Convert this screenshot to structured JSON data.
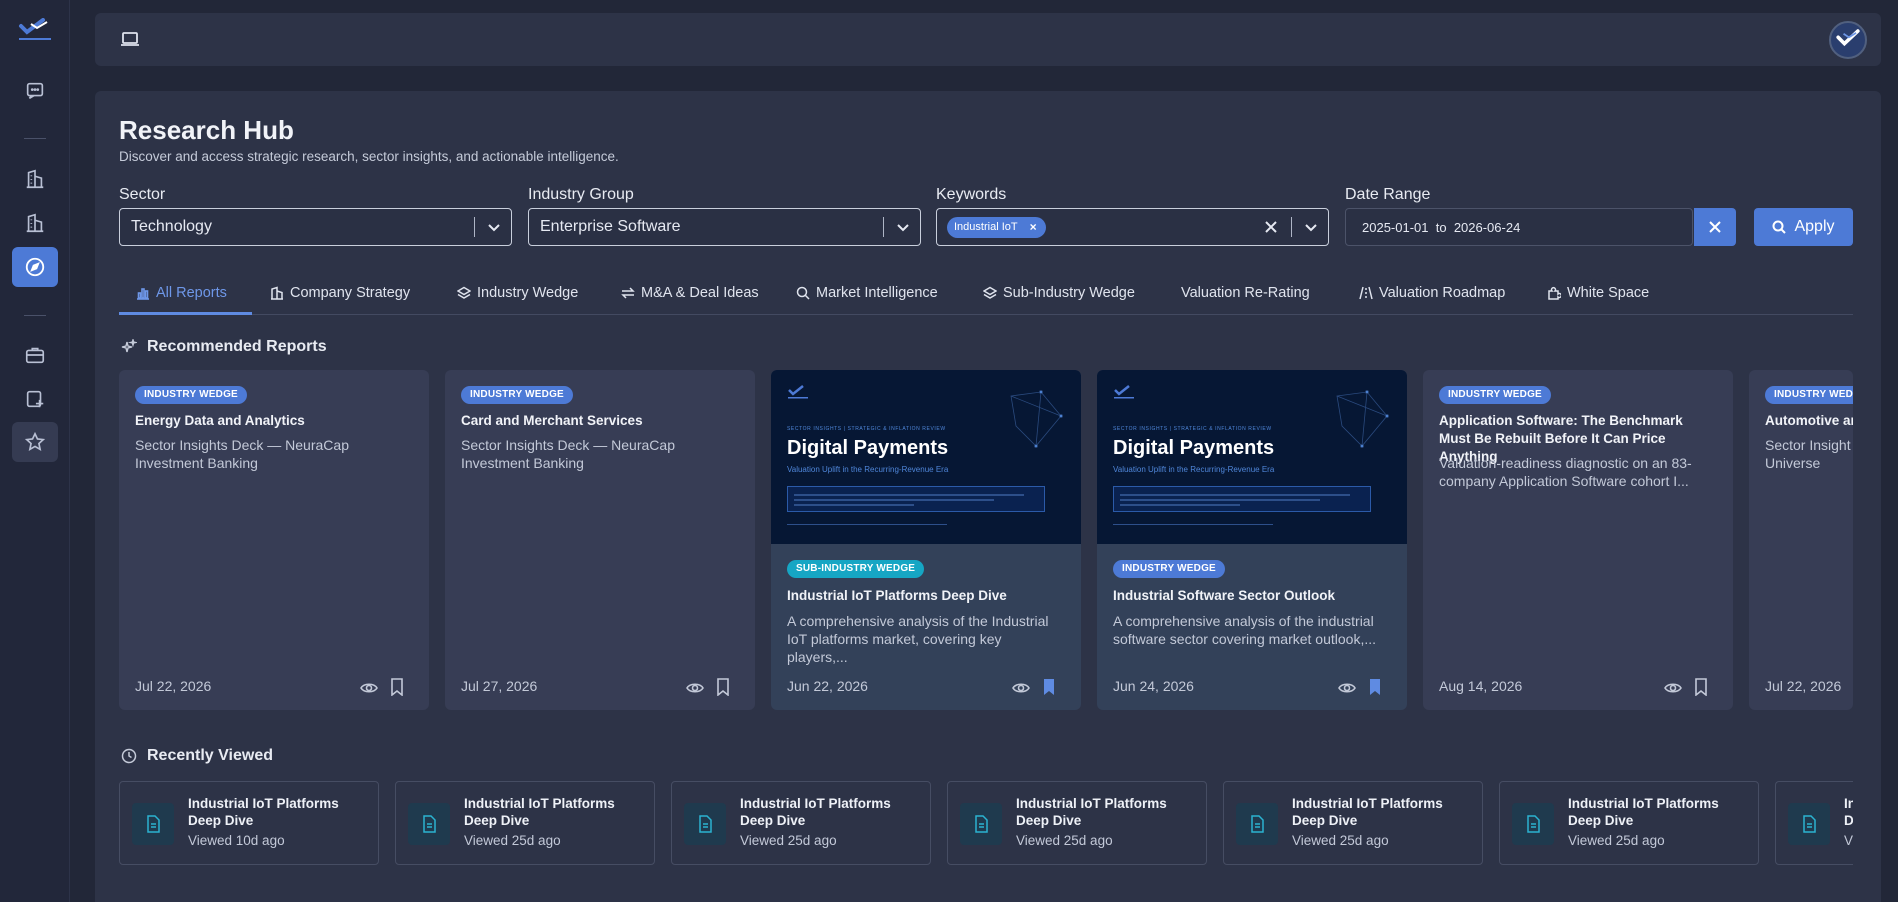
{
  "topbar": {
    "device_icon": "laptop-icon"
  },
  "page": {
    "title": "Research Hub",
    "subtitle": "Discover and access strategic research, sector insights, and actionable intelligence."
  },
  "filters": {
    "sector": {
      "label": "Sector",
      "value": "Technology"
    },
    "industry_group": {
      "label": "Industry Group",
      "value": "Enterprise Software"
    },
    "keywords": {
      "label": "Keywords",
      "chip": "Industrial IoT"
    },
    "date_range": {
      "label": "Date Range",
      "from": "2025-01-01",
      "sep": "to",
      "to": "2026-06-24"
    },
    "apply_label": "Apply"
  },
  "tabs": [
    {
      "label": "All Reports",
      "icon": "bar-chart-icon"
    },
    {
      "label": "Company Strategy",
      "icon": "building-icon"
    },
    {
      "label": "Industry Wedge",
      "icon": "layers-icon"
    },
    {
      "label": "M&A & Deal Ideas",
      "icon": "swap-icon"
    },
    {
      "label": "Market Intelligence",
      "icon": "search-icon"
    },
    {
      "label": "Sub-Industry Wedge",
      "icon": "layers-icon"
    },
    {
      "label": "Valuation Re-Rating",
      "icon": ""
    },
    {
      "label": "Valuation Roadmap",
      "icon": "road-icon"
    },
    {
      "label": "White Space",
      "icon": "puzzle-icon"
    }
  ],
  "recommended": {
    "title": "Recommended Reports",
    "cards": [
      {
        "badge": "INDUSTRY WEDGE",
        "title": "Energy Data and Analytics",
        "desc": "Sector Insights Deck — NeuraCap Investment Banking",
        "date": "Jul 22, 2026",
        "bookmarked": false
      },
      {
        "badge": "INDUSTRY WEDGE",
        "title": "Card and Merchant Services",
        "desc": "Sector Insights Deck — NeuraCap Investment Banking",
        "date": "Jul 27, 2026",
        "bookmarked": false
      },
      {
        "badge": "SUB-INDUSTRY WEDGE",
        "title": "Industrial IoT Platforms Deep Dive",
        "desc": "A comprehensive analysis of the Industrial IoT platforms market, covering key players,...",
        "date": "Jun 22, 2026",
        "bookmarked": true,
        "cover": {
          "kicker": "SECTOR INSIGHTS | STRATEGIC & INFLATION REVIEW",
          "title": "Digital Payments",
          "subtitle": "Valuation Uplift in the Recurring-Revenue Era"
        }
      },
      {
        "badge": "INDUSTRY WEDGE",
        "title": "Industrial Software Sector Outlook",
        "desc": "A comprehensive analysis of the industrial software sector covering market outlook,...",
        "date": "Jun 24, 2026",
        "bookmarked": true,
        "cover": {
          "kicker": "SECTOR INSIGHTS | STRATEGIC & INFLATION REVIEW",
          "title": "Digital Payments",
          "subtitle": "Valuation Uplift in the Recurring-Revenue Era"
        }
      },
      {
        "badge": "INDUSTRY WEDGE",
        "title": "Application Software: The Benchmark Must Be Rebuilt Before It Can Price Anything",
        "desc": "Valuation-readiness diagnostic on an 83-company Application Software cohort I...",
        "date": "Aug 14, 2026",
        "bookmarked": false
      },
      {
        "badge": "INDUSTRY WEDGE",
        "title": "Automotive an",
        "desc": "Sector Insight Universe",
        "date": "Jul 22, 2026",
        "bookmarked": false
      }
    ]
  },
  "recent": {
    "title": "Recently Viewed",
    "items": [
      {
        "title": "Industrial IoT Platforms Deep Dive",
        "time": "Viewed 10d ago"
      },
      {
        "title": "Industrial IoT Platforms Deep Dive",
        "time": "Viewed 25d ago"
      },
      {
        "title": "Industrial IoT Platforms Deep Dive",
        "time": "Viewed 25d ago"
      },
      {
        "title": "Industrial IoT Platforms Deep Dive",
        "time": "Viewed 25d ago"
      },
      {
        "title": "Industrial IoT Platforms Deep Dive",
        "time": "Viewed 25d ago"
      },
      {
        "title": "Industrial IoT Platforms Deep Dive",
        "time": "Viewed 25d ago"
      },
      {
        "title": "In D",
        "time": "V"
      }
    ]
  },
  "colors": {
    "accent": "#4d7ad6",
    "teal": "#16a6c4",
    "bg": "#222738",
    "panel": "#2d3347"
  }
}
